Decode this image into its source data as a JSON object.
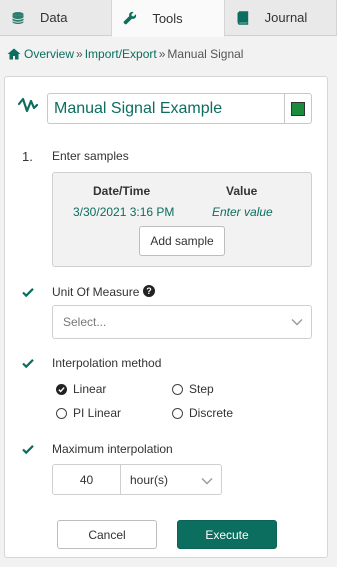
{
  "tabs": [
    {
      "label": "Data",
      "icon": "database-icon"
    },
    {
      "label": "Tools",
      "icon": "wrench-icon"
    },
    {
      "label": "Journal",
      "icon": "book-icon"
    }
  ],
  "active_tab": "Tools",
  "breadcrumb": {
    "items": [
      "Overview",
      "Import/Export",
      "Manual Signal"
    ],
    "separator": "»"
  },
  "signal": {
    "name": "Manual Signal Example",
    "color": "#1a8c3c"
  },
  "step1": {
    "number": "1.",
    "title": "Enter samples"
  },
  "samples": {
    "headers": [
      "Date/Time",
      "Value"
    ],
    "rows": [
      {
        "datetime": "3/30/2021 3:16 PM",
        "value_placeholder": "Enter value"
      }
    ],
    "add_label": "Add sample"
  },
  "unit": {
    "label": "Unit Of Measure",
    "help": "?",
    "placeholder": "Select..."
  },
  "interpolation": {
    "label": "Interpolation method",
    "options": [
      "Linear",
      "Step",
      "PI Linear",
      "Discrete"
    ],
    "selected": "Linear"
  },
  "max_interp": {
    "label": "Maximum interpolation",
    "value": "40",
    "unit": "hour(s)"
  },
  "buttons": {
    "cancel": "Cancel",
    "execute": "Execute"
  },
  "colors": {
    "accent": "#0b6e5f",
    "check": "#0b6e5f"
  }
}
